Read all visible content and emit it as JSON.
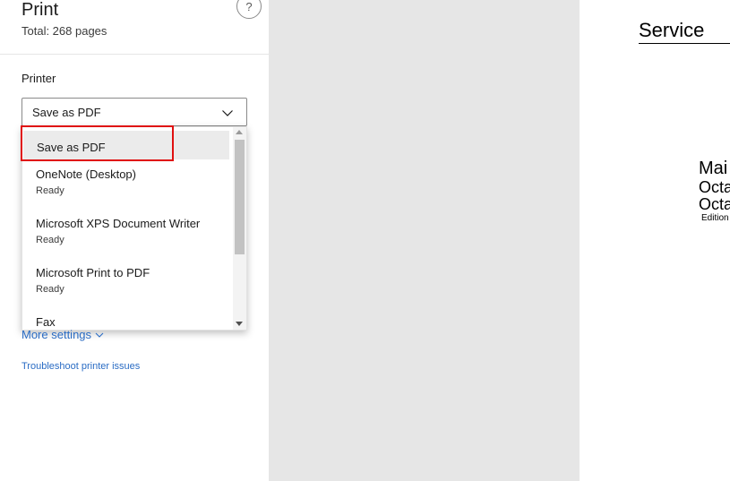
{
  "panel": {
    "title": "Print",
    "subtitle": "Total: 268 pages",
    "help_label": "?"
  },
  "printer": {
    "label": "Printer",
    "selected": "Save as PDF",
    "options": [
      {
        "name": "Save as PDF",
        "status": ""
      },
      {
        "name": "OneNote (Desktop)",
        "status": "Ready"
      },
      {
        "name": "Microsoft XPS Document Writer",
        "status": "Ready"
      },
      {
        "name": "Microsoft Print to PDF",
        "status": "Ready"
      },
      {
        "name": "Fax",
        "status": ""
      }
    ]
  },
  "links": {
    "more_settings": "More settings",
    "troubleshoot": "Troubleshoot printer issues"
  },
  "preview": {
    "heading": "Service",
    "line1": "Mai",
    "line2": "Octa",
    "line3": "Octa",
    "line4": "Edition"
  },
  "colors": {
    "link": "#2a6cc4",
    "highlight": "#e01010",
    "preview_bg": "#e6e6e6"
  },
  "icons": {
    "help": "question-mark",
    "select_chevron": "chevron-down",
    "more_settings_chevron": "chevron-down"
  }
}
